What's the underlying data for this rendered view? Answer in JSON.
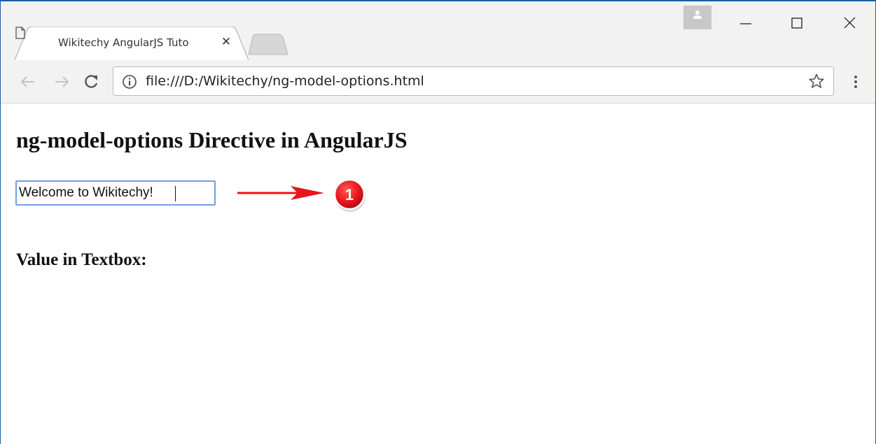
{
  "browser": {
    "tab": {
      "title": "Wikitechy AngularJS Tuto"
    },
    "address_bar": {
      "url": "file:///D:/Wikitechy/ng-model-options.html"
    }
  },
  "page": {
    "heading": "ng-model-options Directive in AngularJS",
    "textbox": {
      "value": "Welcome to Wikitechy!"
    },
    "value_label": "Value in Textbox:"
  },
  "annotation": {
    "badge_number": "1",
    "color": "#e8141b"
  },
  "icons": {
    "tab": "page-icon",
    "close": "close-icon",
    "back": "back-arrow-icon",
    "forward": "forward-arrow-icon",
    "reload": "reload-icon",
    "info": "info-icon",
    "bookmark": "star-icon",
    "menu": "kebab-menu-icon",
    "profile": "person-icon"
  }
}
